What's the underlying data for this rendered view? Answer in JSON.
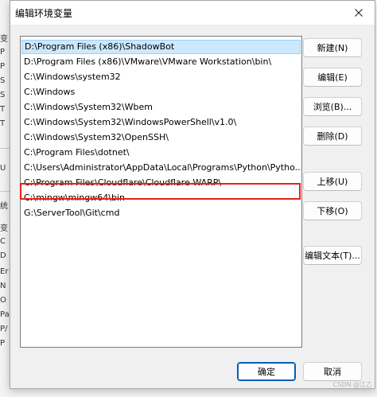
{
  "dialog": {
    "title": "编辑环境变量",
    "paths": [
      "D:\\Program Files (x86)\\ShadowBot",
      "D:\\Program Files (x86)\\VMware\\VMware Workstation\\bin\\",
      "C:\\Windows\\system32",
      "C:\\Windows",
      "C:\\Windows\\System32\\Wbem",
      "C:\\Windows\\System32\\WindowsPowerShell\\v1.0\\",
      "C:\\Windows\\System32\\OpenSSH\\",
      "C:\\Program Files\\dotnet\\",
      "C:\\Users\\Administrator\\AppData\\Local\\Programs\\Python\\Pytho...",
      "C:\\Program Files\\Cloudflare\\Cloudflare WARP\\",
      "C:\\mingw\\mingw64\\bin",
      "G:\\ServerTool\\Git\\cmd"
    ],
    "selected_index": 0,
    "highlighted_index": 10,
    "buttons": {
      "new": "新建(N)",
      "edit": "编辑(E)",
      "browse": "浏览(B)...",
      "delete": "删除(D)",
      "move_up": "上移(U)",
      "move_down": "下移(O)",
      "edit_text": "编辑文本(T)...",
      "ok": "确定",
      "cancel": "取消"
    }
  },
  "background_fragments": [
    "变",
    "P",
    "P",
    "S",
    "S",
    "T",
    "T",
    "U",
    "统",
    "变",
    "C",
    "D",
    "Er",
    "N",
    "O",
    "Pa",
    "P/",
    "P"
  ],
  "watermark": "CSDN @江乙",
  "colors": {
    "selection": "#cce8ff",
    "highlight_box": "#e8201a",
    "primary_border": "#005fb8"
  }
}
